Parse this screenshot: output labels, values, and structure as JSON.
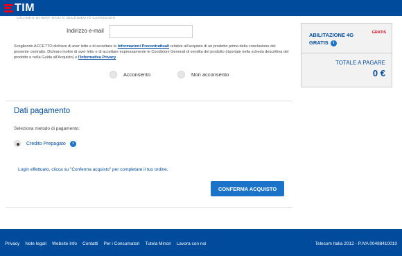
{
  "header": {
    "logo_text": "TIM"
  },
  "form": {
    "faded_text": "Dichiaro di aver letto e accettato le Condizioni",
    "email_label": "Indirizzo e-mail",
    "email_value": "",
    "legal": {
      "part1": "Scegliendo ACCETTO dichiaro di aver letto e di accettare le ",
      "link1": "Informazioni Precontrattuali",
      "part2": " relative all'acquisto di un prodotto prima della conclusione del presente contratto. Dichiaro inoltre di aver letto e di accettare espressamente le Condizioni Generali di vendita del prodotto (riportate nella scheda descrittiva del prodotto e nella Guida all'Acquisto) e ",
      "link2": "l'Informativa Privacy"
    },
    "consent_yes": "Acconsento",
    "consent_no": "Non acconsento"
  },
  "payment": {
    "title": "Dati pagamento",
    "select_label": "Seleziona metodo di pagamento:",
    "method": "Credito Prepagato",
    "login_message": "Login effettuato, clicca su \"Conferma acquisto\" per completare il tuo ordine.",
    "confirm_button": "CONFERMA ACQUISTO"
  },
  "summary": {
    "item": "ABILITAZIONE 4G GRATIS",
    "badge": "GRATIS",
    "total_label": "TOTALE A PAGARE",
    "total_value": "0 €"
  },
  "footer": {
    "links": [
      "Privacy",
      "Note legali",
      "Website Info",
      "Contatti",
      "Per i Consumatori",
      "Tutela Minori",
      "Lavora con noi"
    ],
    "copyright": "Telecom Italia 2012 - P.IVA 00488410010"
  },
  "colors": {
    "brand_blue": "#004b9b",
    "accent_red": "#e2001a",
    "button_blue": "#1a73c9"
  },
  "icons": {
    "info": "info-icon"
  }
}
